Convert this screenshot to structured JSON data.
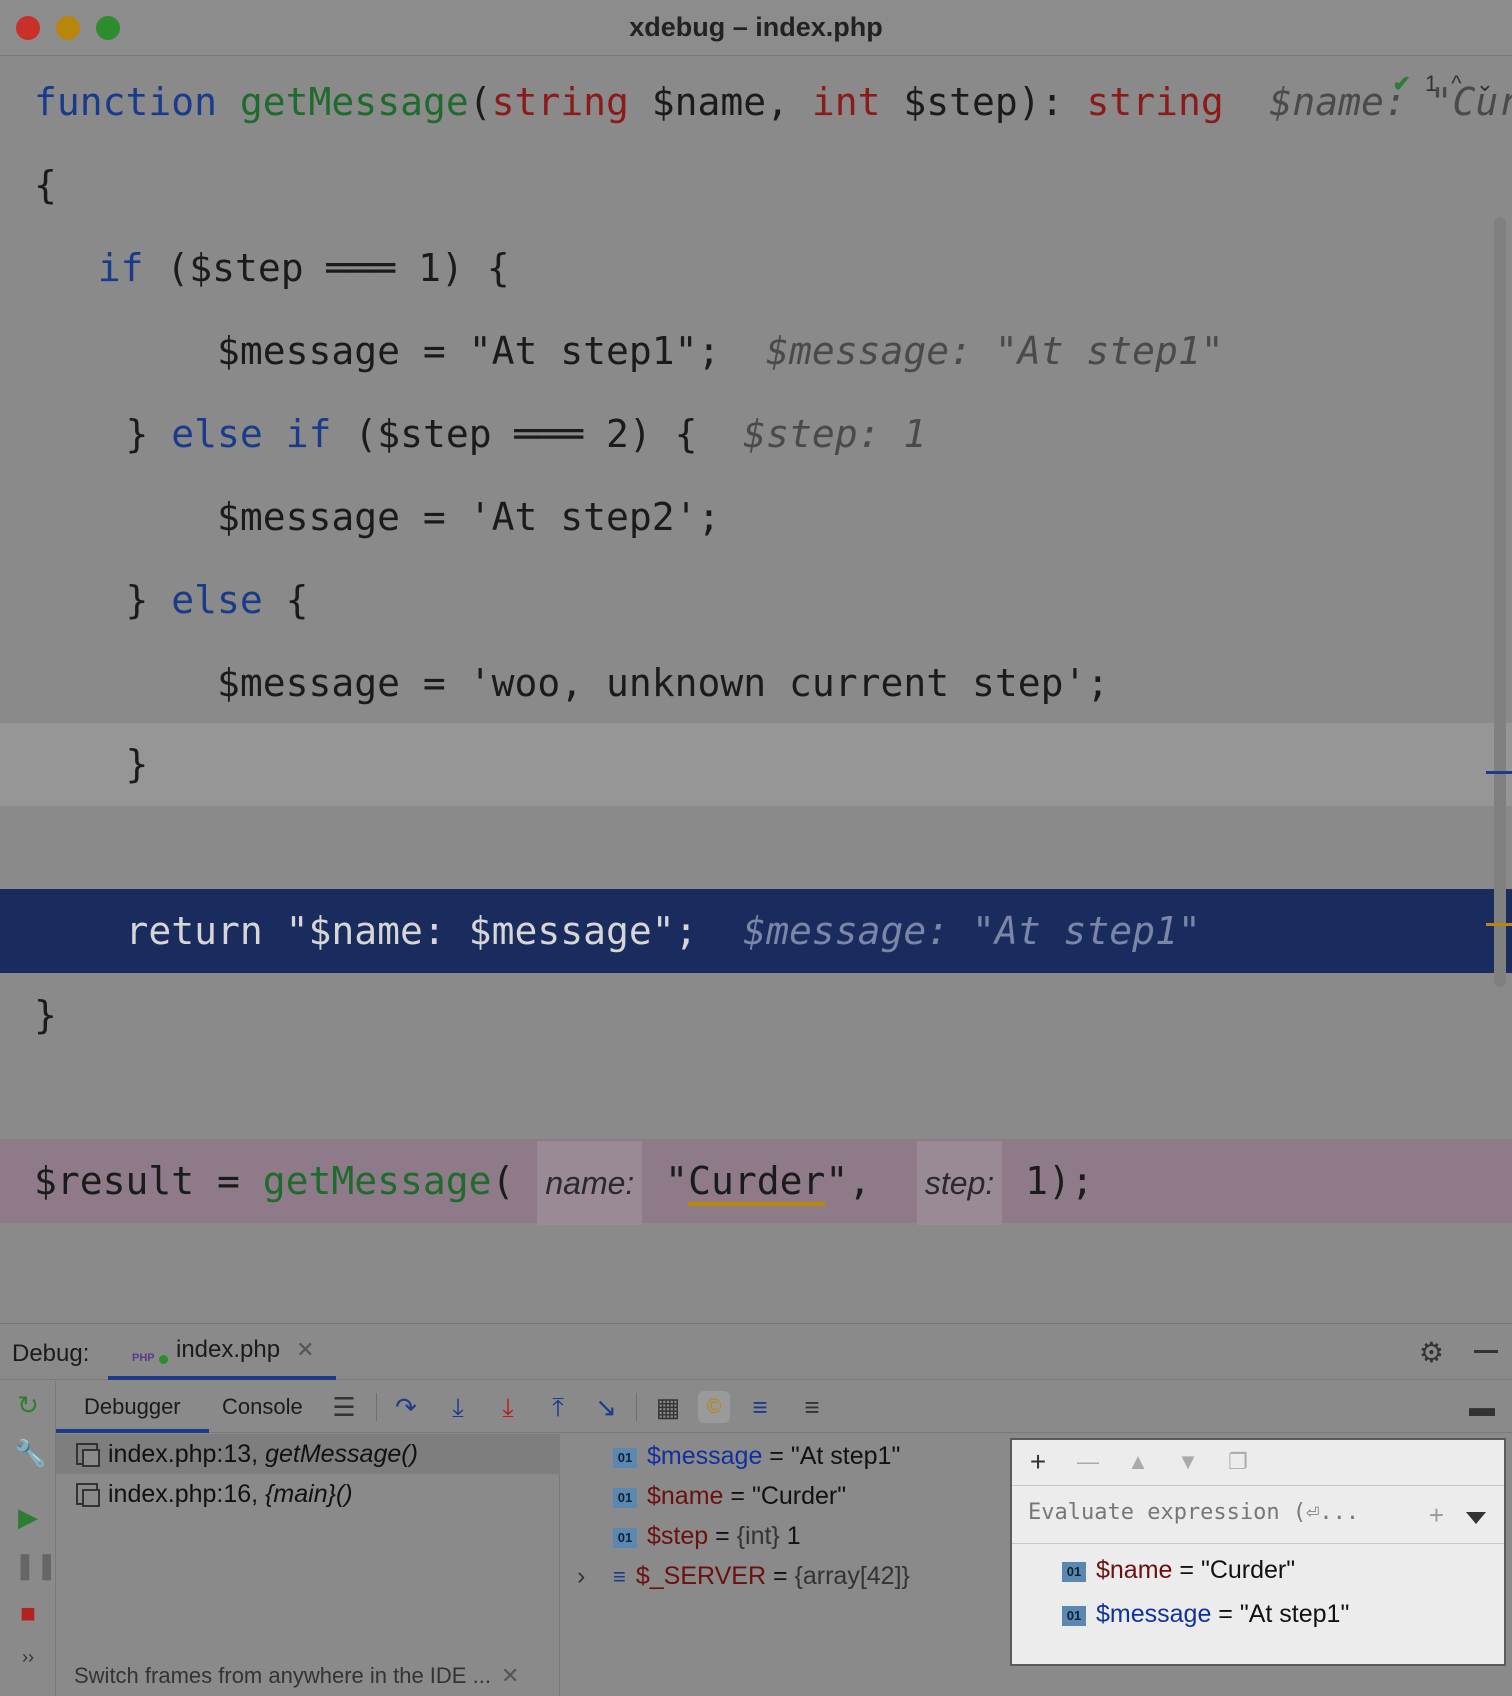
{
  "window": {
    "title": "xdebug – index.php"
  },
  "editor": {
    "inspection": {
      "count": "1",
      "up": "^",
      "down": "⌄"
    },
    "lines": {
      "l1": {
        "kw_function": "function",
        "fn_name": "getMessage",
        "paren_open": "(",
        "type_string": "string",
        "param_name": " $name, ",
        "type_int": "int",
        "param_step": " $step): ",
        "return_type": "string",
        "hint": "  $name: \"Curde"
      },
      "l2": {
        "text": "{"
      },
      "l3": {
        "indent": "  ",
        "kw_if": "if",
        "rest": " ($step ═══ 1) {"
      },
      "l4": {
        "indent": "        ",
        "code": "$message = \"At step1\";",
        "hint": "  $message: \"At step1\""
      },
      "l5": {
        "brace": "    } ",
        "kw_else": "else",
        "space": " ",
        "kw_if": "if",
        "rest": " ($step ═══ 2) {",
        "hint": "  $step: 1"
      },
      "l6": {
        "indent": "        ",
        "code": "$message = 'At step2';"
      },
      "l7": {
        "brace": "    } ",
        "kw_else": "else",
        "rest": " {"
      },
      "l8": {
        "indent": "        ",
        "code": "$message = 'woo, unknown current step';"
      },
      "l9": {
        "text": "    }"
      },
      "l10": {
        "indent": "    ",
        "code": "return \"$name: $message\";",
        "hint": "  $message: \"At step1\""
      },
      "l11": {
        "text": "}"
      },
      "l12": {
        "var": "$result = ",
        "fn": "getMessage",
        "paren": "(",
        "hint_name": "name:",
        "arg1_q1": "\"",
        "arg1": "Curder",
        "arg1_q2": "\",",
        "hint_step": "step:",
        "arg2": "1);"
      }
    }
  },
  "debug": {
    "label": "Debug:",
    "tab": {
      "name": "index.php",
      "icon_text": "PHP",
      "close": "✕"
    },
    "subtabs": {
      "debugger": "Debugger",
      "console": "Console"
    },
    "frames": [
      {
        "loc": "index.php:13, ",
        "fn": "getMessage()"
      },
      {
        "loc": "index.php:16, ",
        "fn": "{main}()"
      }
    ],
    "frames_hint": "Switch frames from anywhere in the IDE ...",
    "frames_hint_close": "✕",
    "variables": [
      {
        "badge": "01",
        "name": "$message",
        "eq": " = ",
        "type": "",
        "value": "\"At step1\""
      },
      {
        "badge": "01",
        "name": "$name",
        "eq": " = ",
        "type": "",
        "value": "\"Curder\""
      },
      {
        "badge": "01",
        "name": "$step",
        "eq": " = ",
        "type": "{int} ",
        "value": "1"
      },
      {
        "badge": "",
        "name": "$_SERVER",
        "eq": " = ",
        "type": "{array[42]}",
        "value": ""
      }
    ],
    "evaluate": {
      "placeholder": "Evaluate expression (⏎...",
      "watches": [
        {
          "badge": "01",
          "name": "$name",
          "eq": " = ",
          "value": "\"Curder\""
        },
        {
          "badge": "01",
          "name": "$message",
          "eq": " = ",
          "value": "\"At step1\""
        }
      ]
    }
  }
}
